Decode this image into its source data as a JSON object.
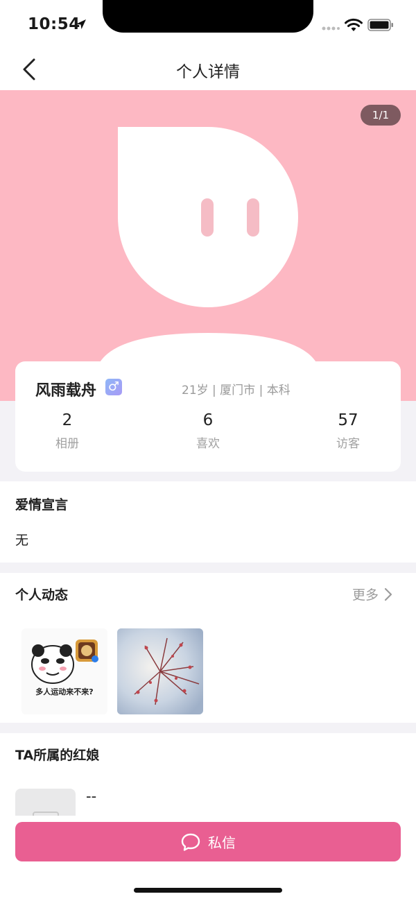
{
  "status_bar": {
    "time": "10:54"
  },
  "nav": {
    "title": "个人详情"
  },
  "hero": {
    "photo_counter": "1/1"
  },
  "profile": {
    "name": "风雨载舟",
    "gender_symbol": "♂",
    "info": "21岁 | 厦门市 | 本科",
    "stats": [
      {
        "value": "2",
        "label": "相册"
      },
      {
        "value": "6",
        "label": "喜欢"
      },
      {
        "value": "57",
        "label": "访客"
      }
    ]
  },
  "declaration": {
    "title": "爱情宣言",
    "text": "无"
  },
  "moments": {
    "title": "个人动态",
    "more_label": "更多",
    "thumb1_caption": "多人运动来不来?"
  },
  "matchmaker": {
    "title": "TA所属的红娘",
    "name": "--"
  },
  "actions": {
    "message_label": "私信"
  },
  "colors": {
    "hero_bg": "#fdb8c3",
    "accent": "#e95f92",
    "section_bg": "#f3f2f6"
  }
}
